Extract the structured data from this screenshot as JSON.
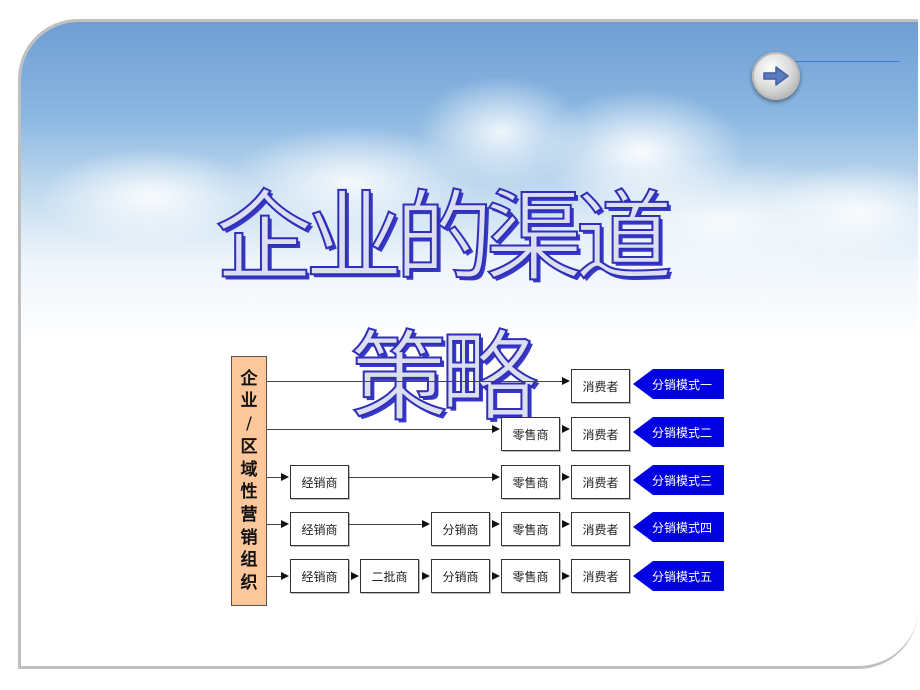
{
  "slide": {
    "title": "企业的渠道策略",
    "nav_button": {
      "icon": "arrow-right-icon",
      "label": "next"
    }
  },
  "diagram": {
    "source_label_chars": [
      "企",
      "业",
      "/",
      "区",
      "域",
      "性",
      "营",
      "销",
      "组",
      "织"
    ],
    "source_label": "企业/区域性营销组织",
    "rows": [
      {
        "mode": "分销模式一",
        "nodes": [
          "消费者"
        ]
      },
      {
        "mode": "分销模式二",
        "nodes": [
          "零售商",
          "消费者"
        ]
      },
      {
        "mode": "分销模式三",
        "nodes": [
          "经销商",
          "零售商",
          "消费者"
        ]
      },
      {
        "mode": "分销模式四",
        "nodes": [
          "经销商",
          "分销商",
          "零售商",
          "消费者"
        ]
      },
      {
        "mode": "分销模式五",
        "nodes": [
          "经销商",
          "二批商",
          "分销商",
          "零售商",
          "消费者"
        ]
      }
    ]
  },
  "colors": {
    "source_box": "#fbc79b",
    "mode_tag": "#0000e0",
    "title_stroke": "#2f2fb8",
    "frame_border": "#c0c0c0"
  }
}
